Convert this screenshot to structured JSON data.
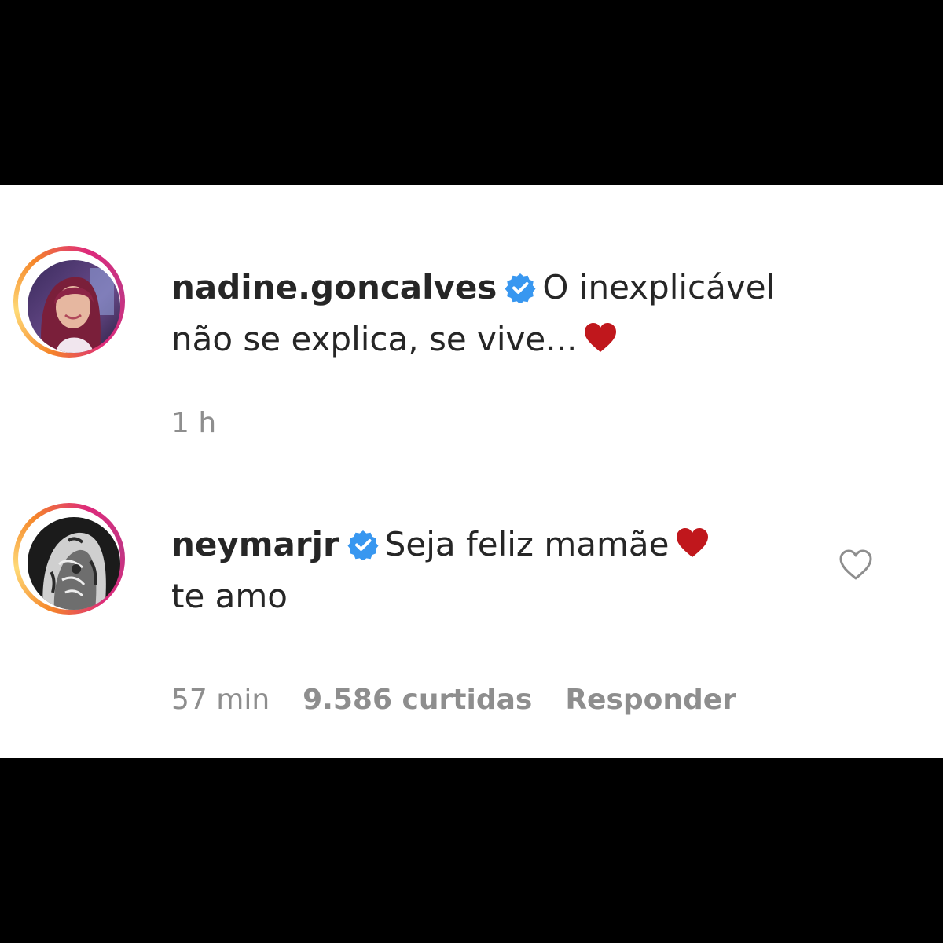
{
  "comments": [
    {
      "username": "nadine.goncalves",
      "verified": true,
      "text": "O inexplicável não se explica, se vive...",
      "emoji": "heart-emoji",
      "time": "1 h"
    },
    {
      "username": "neymarjr",
      "verified": true,
      "text": "Seja feliz mamãe",
      "emoji": "heart-emoji",
      "text_after_emoji": "te amo",
      "time": "57 min",
      "likes": "9.586 curtidas",
      "reply_label": "Responder"
    }
  ],
  "colors": {
    "verified": "#3897f0",
    "heart": "#c0171c",
    "meta_text": "#8e8e8e",
    "primary_text": "#262626"
  }
}
